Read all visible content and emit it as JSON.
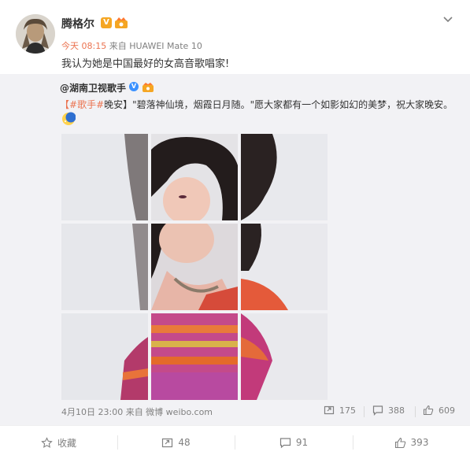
{
  "author": {
    "name": "腾格尔",
    "verified_badge": "V"
  },
  "meta": {
    "time": "今天 08:15",
    "source": "来自 HUAWEI Mate 10"
  },
  "post_text": "我认为她是中国最好的女高音歌唱家!",
  "repost": {
    "user": "@湖南卫视歌手",
    "verified_badge": "V",
    "text_prefix": "【",
    "topic": "#歌手#",
    "text_rest": "晚安】\"碧落神仙境，烟霞日月随。\"愿大家都有一个如影如幻的美梦，祝大家晚安。",
    "timestamp": "4月10日 23:00 来自 微博 weibo.com",
    "stats": {
      "reposts": "175",
      "comments": "388",
      "likes": "609"
    }
  },
  "actions": {
    "favorite": "收藏",
    "repost": "48",
    "comment": "91",
    "like": "393"
  },
  "icons": [
    "chevron-down-icon",
    "verified-v-icon",
    "crown-badge-icon",
    "moon-emoji-icon",
    "repost-icon",
    "comment-icon",
    "like-icon",
    "favorite-icon"
  ],
  "colors": {
    "accent": "#eb7350",
    "verified_orange": "#f5a623",
    "verified_blue": "#3b91ff",
    "repost_bg": "#f2f2f5"
  }
}
